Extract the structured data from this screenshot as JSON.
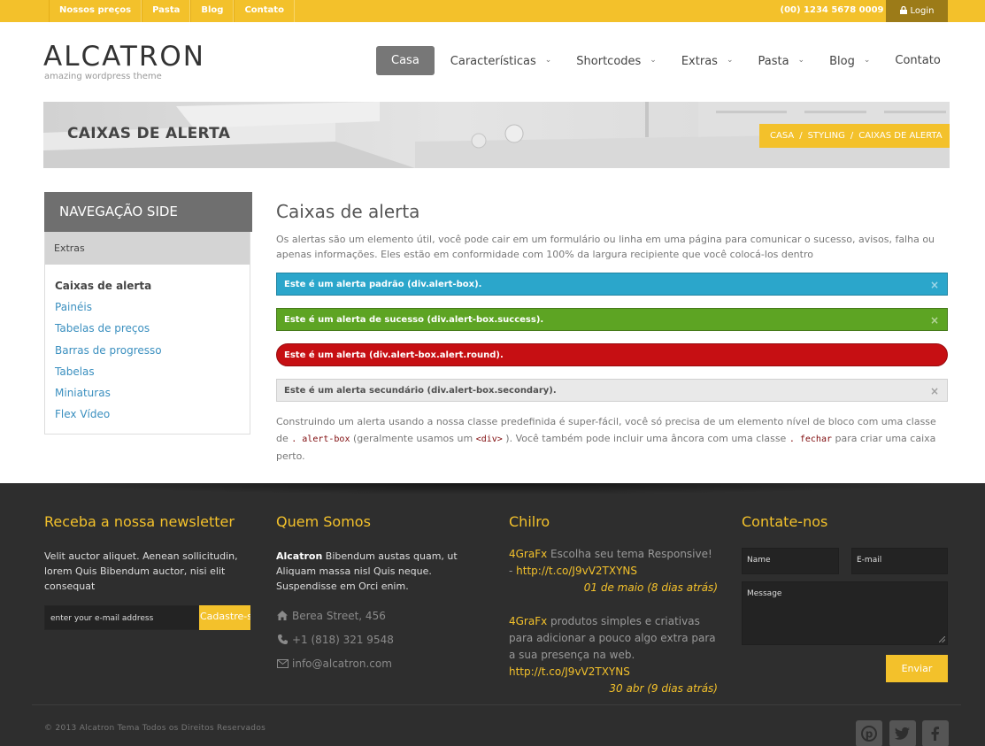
{
  "topbar": {
    "links": [
      "Nossos preços",
      "Pasta",
      "Blog",
      "Contato"
    ],
    "phone": "(00) 1234 5678 0009",
    "login": "Login"
  },
  "header": {
    "logo": "ALCATRON",
    "tagline": "amazing wordpress theme",
    "nav": [
      {
        "label": "Casa",
        "active": true,
        "dropdown": false
      },
      {
        "label": "Características",
        "active": false,
        "dropdown": true
      },
      {
        "label": "Shortcodes",
        "active": false,
        "dropdown": true
      },
      {
        "label": "Extras",
        "active": false,
        "dropdown": true
      },
      {
        "label": "Pasta",
        "active": false,
        "dropdown": true
      },
      {
        "label": "Blog",
        "active": false,
        "dropdown": true
      },
      {
        "label": "Contato",
        "active": false,
        "dropdown": false
      }
    ]
  },
  "banner": {
    "title": "CAIXAS DE ALERTA",
    "breadcrumb": [
      "CASA",
      "STYLING",
      "CAIXAS DE ALERTA"
    ],
    "separator": "/"
  },
  "sidebar": {
    "title": "NAVEGAÇÃO SIDE",
    "section": "Extras",
    "items": [
      {
        "label": "Caixas de alerta",
        "current": true
      },
      {
        "label": "Painéis",
        "current": false
      },
      {
        "label": "Tabelas de preços",
        "current": false
      },
      {
        "label": "Barras de progresso",
        "current": false
      },
      {
        "label": "Tabelas",
        "current": false
      },
      {
        "label": "Miniaturas",
        "current": false
      },
      {
        "label": "Flex Vídeo",
        "current": false
      }
    ]
  },
  "main": {
    "title": "Caixas de alerta",
    "intro": "Os alertas são um elemento útil, você pode cair em um formulário ou linha em uma página para comunicar o sucesso, avisos, falha ou apenas informações. Eles estão em conformidade com 100% da largura recipiente que você colocá-los dentro",
    "alerts": {
      "standard": "Este é um alerta padrão (div.alert-box).",
      "success": "Este é um alerta de sucesso (div.alert-box.success).",
      "round": "Este é um alerta (div.alert-box.alert.round).",
      "secondary": "Este é um alerta secundário (div.alert-box.secondary).",
      "close": "×"
    },
    "para2": {
      "t1": "Construindo um alerta usando a nossa classe predefinida é super-fácil, você só precisa de um elemento nível de bloco com uma classe de ",
      "c1": ". alert-box",
      "t2": " (geralmente usamos um ",
      "c2": "<div>",
      "t3": " ). Você também pode incluir uma âncora com uma classe ",
      "c3": ". fechar",
      "t4": " para criar uma caixa perto."
    },
    "colors": {
      "standard": "#2ba6cb",
      "success": "#5da423",
      "alert": "#c60f13",
      "secondary": "#e9e9e9",
      "accent": "#f3c12b"
    }
  },
  "footer": {
    "newsletter": {
      "title": "Receba a nossa newsletter",
      "text": "Velit auctor aliquet. Aenean sollicitudin, lorem Quis Bibendum auctor, nisi elit consequat",
      "placeholder": "enter your e-mail address",
      "button": "Cadastre-se"
    },
    "about": {
      "title": "Quem Somos",
      "brand": "Alcatron",
      "text": " Bibendum austas quam, ut Aliquam massa nisl Quis neque. Suspendisse em Orci enim.",
      "address": "Berea Street, 456",
      "phone": "+1 (818) 321 9548",
      "email": "info@alcatron.com"
    },
    "twitter": {
      "title": "Chilro",
      "tweets": [
        {
          "user": "4GraFx",
          "text": " Escolha seu tema Responsive! - ",
          "url": "http://t.co/J9vV2TXYNS",
          "when": "01 de maio (8 dias atrás)"
        },
        {
          "user": "4GraFx",
          "text": " produtos simples e criativas para adicionar a pouco algo extra para a sua presença na web. ",
          "url": "http://t.co/J9vV2TXYNS",
          "when": "30 abr (9 dias atrás)"
        }
      ]
    },
    "contact": {
      "title": "Contate-nos",
      "name_placeholder": "Name",
      "email_placeholder": "E-mail",
      "message_placeholder": "Message",
      "send": "Enviar"
    },
    "copyright": "© 2013 Alcatron Tema Todos os Direitos Reservados",
    "social": [
      "pinterest-icon",
      "twitter-icon",
      "facebook-icon"
    ]
  }
}
